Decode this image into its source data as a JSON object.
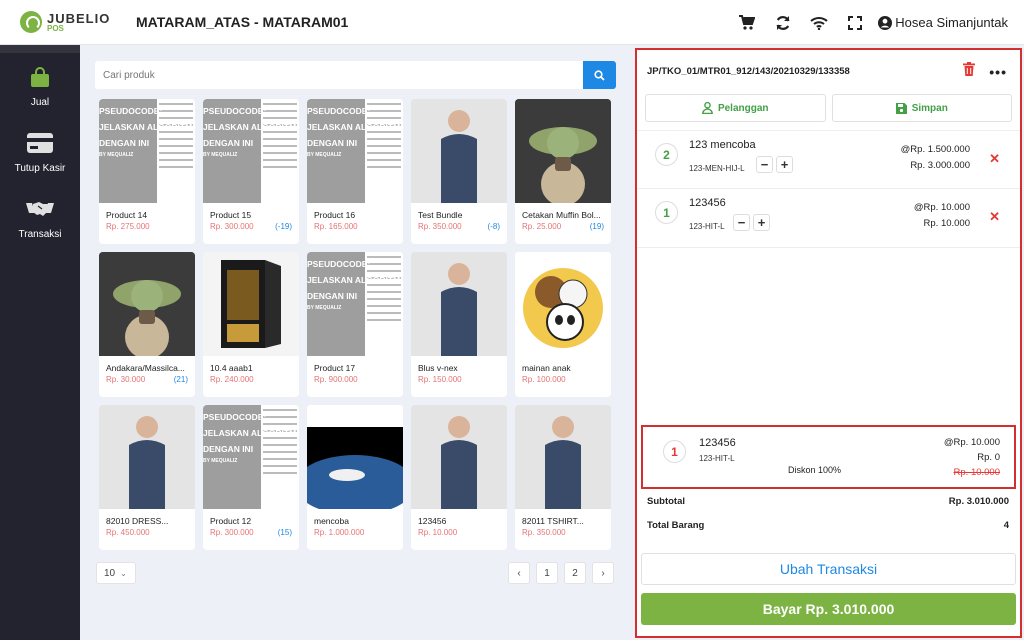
{
  "app": {
    "logo_main": "JUBELIO",
    "logo_sub": "POS",
    "store_title": "MATARAM_ATAS - MATARAM01",
    "user_name": "Hosea Simanjuntak",
    "top_icons": [
      "cart-icon",
      "sync-icon",
      "wifi-icon",
      "fullscreen-icon",
      "user-icon"
    ]
  },
  "sidebar": {
    "items": [
      {
        "label": "Jual",
        "icon": "bag-icon"
      },
      {
        "label": "Tutup Kasir",
        "icon": "card-icon"
      },
      {
        "label": "Transaksi",
        "icon": "handshake-icon"
      }
    ]
  },
  "search": {
    "placeholder": "Cari produk"
  },
  "products": [
    {
      "name": "Product 14",
      "price": "Rp. 275.000",
      "stock": "",
      "img": "pseudo"
    },
    {
      "name": "Product 15",
      "price": "Rp. 300.000",
      "stock": "(-19)",
      "img": "pseudo"
    },
    {
      "name": "Product 16",
      "price": "Rp. 165.000",
      "stock": "",
      "img": "pseudo"
    },
    {
      "name": "Test Bundle",
      "price": "Rp. 350.000",
      "stock": "(-8)",
      "img": "photo"
    },
    {
      "name": "Cetakan Muffin Bol...",
      "price": "Rp. 25.000",
      "stock": "(19)",
      "img": "yoda"
    },
    {
      "name": "Andakara/Massilca...",
      "price": "Rp. 30.000",
      "stock": "(21)",
      "img": "yoda"
    },
    {
      "name": "10.4 aaab1",
      "price": "Rp. 240.000",
      "stock": "",
      "img": "safe"
    },
    {
      "name": "Product 17",
      "price": "Rp. 900.000",
      "stock": "",
      "img": "pseudo"
    },
    {
      "name": "Blus v-nex",
      "price": "Rp. 150.000",
      "stock": "",
      "img": "photo"
    },
    {
      "name": "mainan anak",
      "price": "Rp. 100.000",
      "stock": "",
      "img": "bears"
    },
    {
      "name": "82010 DRESS...",
      "price": "Rp. 450.000",
      "stock": "",
      "img": "photo"
    },
    {
      "name": "Product 12",
      "price": "Rp. 300.000",
      "stock": "(15)",
      "img": "pseudo"
    },
    {
      "name": "mencoba",
      "price": "Rp. 1.000.000",
      "stock": "",
      "img": "earth"
    },
    {
      "name": "123456",
      "price": "Rp. 10.000",
      "stock": "",
      "img": "photo"
    },
    {
      "name": "82011 TSHIRT...",
      "price": "Rp. 350.000",
      "stock": "",
      "img": "photo"
    }
  ],
  "pseudo_text": [
    "PSEUDOCODE:",
    "JELASKAN ALGORITMA",
    "DENGAN INI",
    "BY MEQUALIZ"
  ],
  "pagination": {
    "per_page": "10",
    "prev": "‹",
    "next": "›",
    "pages": [
      "1",
      "2"
    ]
  },
  "cart": {
    "code": "JP/TKO_01/MTR01_912/143/20210329/133358",
    "more": "•••",
    "customer_btn": "Pelanggan",
    "save_btn": "Simpan",
    "items": [
      {
        "qty": "2",
        "name": "123 mencoba",
        "sku": "123-MEN-HIJ-L",
        "unit": "@Rp. 1.500.000",
        "total": "Rp. 3.000.000"
      },
      {
        "qty": "1",
        "name": "123456",
        "sku": "123-HIT-L",
        "unit": "@Rp. 10.000",
        "total": "Rp. 10.000"
      }
    ],
    "promo": {
      "qty": "1",
      "name": "123456",
      "sku": "123-HIT-L",
      "discount": "Diskon 100%",
      "unit": "@Rp. 10.000",
      "price": "Rp. 0",
      "strike": "Rp. 10.000"
    },
    "subtotal_label": "Subtotal",
    "subtotal_value": "Rp. 3.010.000",
    "total_items_label": "Total Barang",
    "total_items_value": "4",
    "ubah_btn": "Ubah Transaksi",
    "bayar_btn": "Bayar Rp. 3.010.000"
  },
  "colors": {
    "green": "#7cb342",
    "blue": "#1e88e5",
    "red": "#e53935",
    "sidebar": "#232330"
  }
}
